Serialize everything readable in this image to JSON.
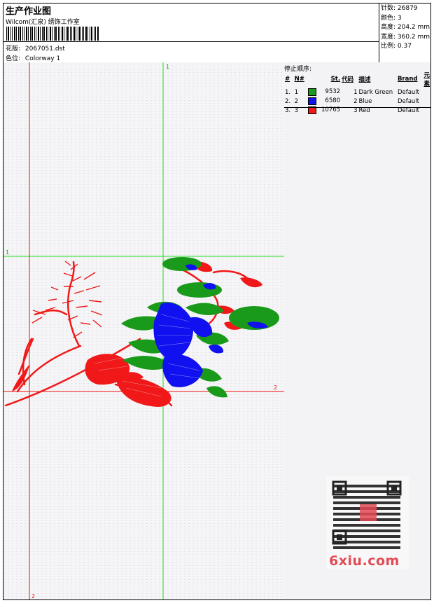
{
  "header": {
    "title": "生产作业图",
    "company": "Wilcom(汇泉) 绣饰工作室",
    "pattern_label": "花版:",
    "pattern_value": "2067051.dst",
    "colorway_label": "色位:",
    "colorway_value": "Colorway 1"
  },
  "stats": {
    "stitches": "针数: 26879",
    "colors": "颜色: 3",
    "height": "高度: 204.2 mm",
    "width": "宽度: 360.2 mm",
    "scale": "比例: 0.37"
  },
  "stop_sequence": {
    "title": "停止顺序:",
    "columns": [
      "#",
      "N#",
      "St.",
      "代码",
      "描述",
      "Brand",
      "元素"
    ],
    "rows": [
      {
        "idx": "1.",
        "n": "1",
        "color": "#1a9a1a",
        "st": "9532",
        "code": "1",
        "desc": "Dark Green",
        "brand": "Default"
      },
      {
        "idx": "2.",
        "n": "2",
        "color": "#1010f0",
        "st": "6580",
        "code": "2",
        "desc": "Blue",
        "brand": "Default"
      },
      {
        "idx": "3.",
        "n": "3",
        "color": "#f01818",
        "st": "10765",
        "code": "3",
        "desc": "Red",
        "brand": "Default"
      }
    ]
  },
  "guides": {
    "top_label": "1",
    "left_label": "1",
    "right_label": "2",
    "bottom_label": "2"
  },
  "watermark": {
    "logo_text": "6xiu.com"
  }
}
